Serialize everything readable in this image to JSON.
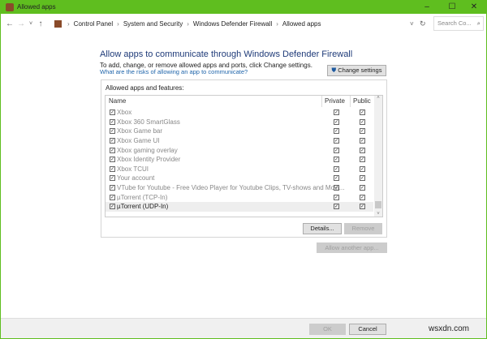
{
  "window": {
    "title": "Allowed apps",
    "minimize": "–",
    "maximize": "☐",
    "close": "✕"
  },
  "addressbar": {
    "back": "←",
    "forward": "→",
    "recent": "˅",
    "up": "↑",
    "crumbs": [
      "Control Panel",
      "System and Security",
      "Windows Defender Firewall",
      "Allowed apps"
    ],
    "separator": "›",
    "dropdown": "˅",
    "refresh": "↻",
    "search_placeholder": "Search Co...",
    "search_icon": "⌕"
  },
  "main": {
    "heading": "Allow apps to communicate through Windows Defender Firewall",
    "subtitle": "To add, change, or remove allowed apps and ports, click Change settings.",
    "risk_link": "What are the risks of allowing an app to communicate?",
    "change_settings": "Change settings",
    "panel_label": "Allowed apps and features:",
    "columns": {
      "name": "Name",
      "private": "Private",
      "public": "Public"
    },
    "apps": [
      {
        "name": "Xbox",
        "enabled": true,
        "private": true,
        "public": true
      },
      {
        "name": "Xbox 360 SmartGlass",
        "enabled": true,
        "private": true,
        "public": true
      },
      {
        "name": "Xbox Game bar",
        "enabled": true,
        "private": true,
        "public": true
      },
      {
        "name": "Xbox Game UI",
        "enabled": true,
        "private": true,
        "public": true
      },
      {
        "name": "Xbox gaming overlay",
        "enabled": true,
        "private": true,
        "public": true
      },
      {
        "name": "Xbox Identity Provider",
        "enabled": true,
        "private": true,
        "public": true
      },
      {
        "name": "Xbox TCUI",
        "enabled": true,
        "private": true,
        "public": true
      },
      {
        "name": "Your account",
        "enabled": true,
        "private": true,
        "public": true
      },
      {
        "name": "VTube for Youtube - Free Video Player for Youtube Clips, TV-shows and Movi...",
        "enabled": true,
        "private": true,
        "public": true
      },
      {
        "name": "µTorrent (TCP-In)",
        "enabled": true,
        "private": true,
        "public": true
      },
      {
        "name": "µTorrent (UDP-In)",
        "enabled": true,
        "private": true,
        "public": true,
        "selected": true
      }
    ],
    "details": "Details...",
    "remove": "Remove",
    "allow_another": "Allow another app..."
  },
  "footer": {
    "ok": "OK",
    "cancel": "Cancel"
  },
  "watermark": "wsxdn.com"
}
